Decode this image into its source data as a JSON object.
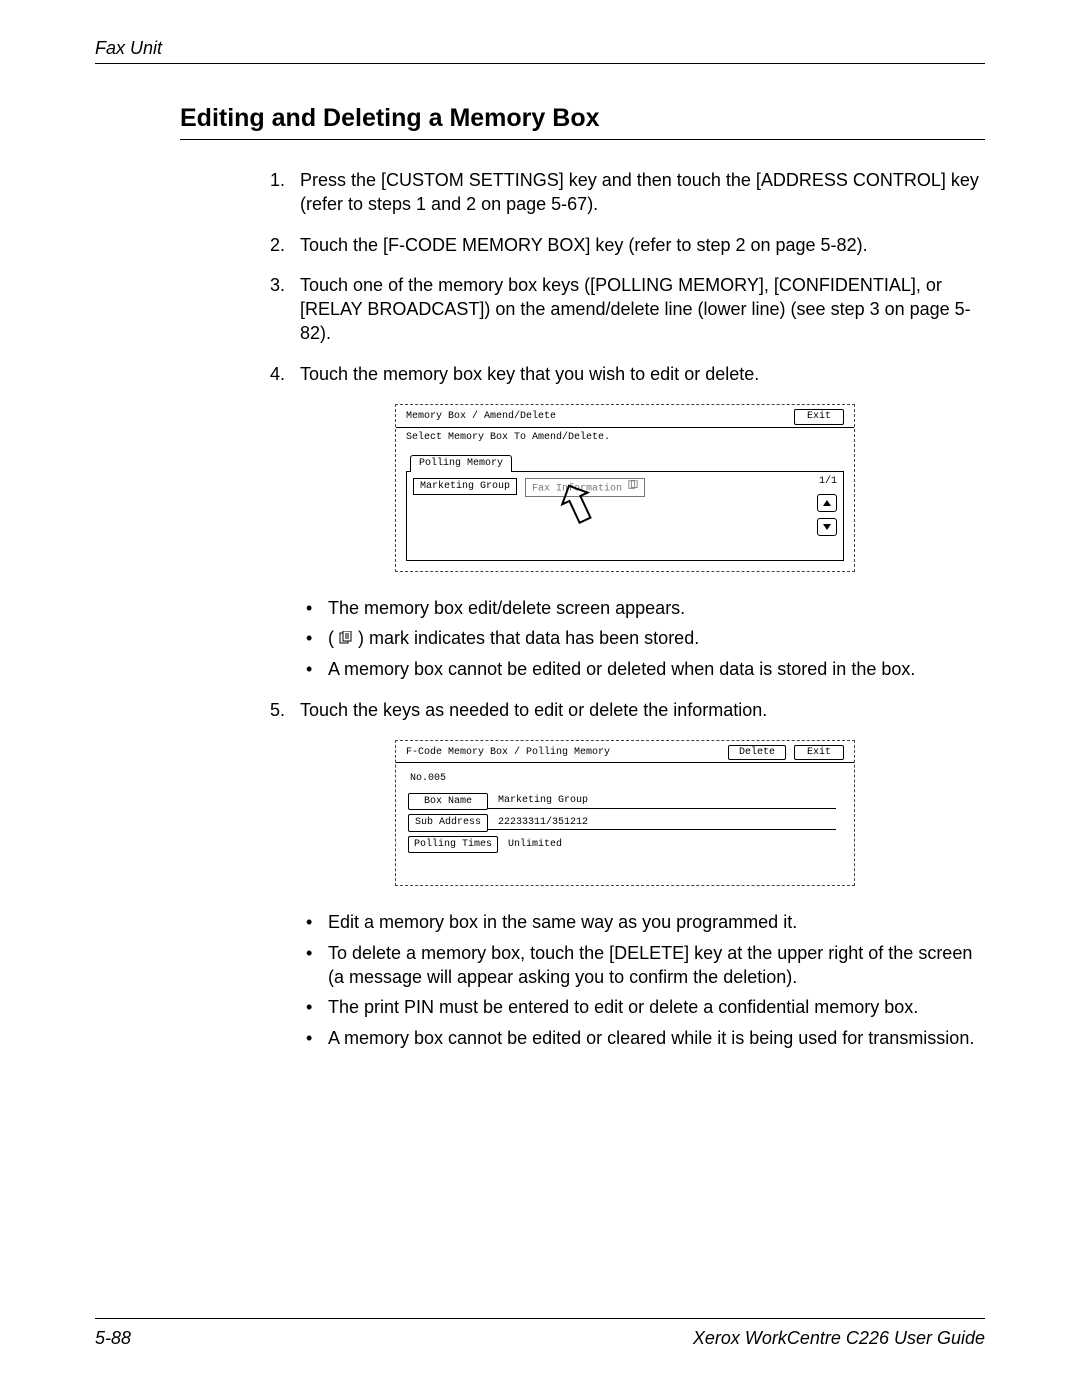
{
  "runningHead": "Fax Unit",
  "sectionTitle": "Editing and Deleting a Memory Box",
  "steps": {
    "s1": "Press the [CUSTOM SETTINGS] key and then touch the [ADDRESS CONTROL] key (refer to steps 1 and 2 on page 5-67).",
    "s2": "Touch the [F-CODE MEMORY BOX] key (refer to step 2 on page 5-82).",
    "s3": "Touch one of the memory box keys ([POLLING MEMORY], [CONFIDENTIAL], or [RELAY BROADCAST]) on the amend/delete line (lower line) (see step 3 on page 5-82).",
    "s4": "Touch the memory box key that you wish to edit or delete.",
    "s5": "Touch the keys as needed to edit or delete the information."
  },
  "panel1": {
    "title": "Memory Box / Amend/Delete",
    "exit": "Exit",
    "prompt": "Select Memory Box To Amend/Delete.",
    "tab": "Polling Memory",
    "key1": "Marketing Group",
    "key2": "Fax Information",
    "pager": "1/1"
  },
  "bulletsA": {
    "b1": "The memory box edit/delete screen appears.",
    "b2a": "( ",
    "b2b": " ) mark indicates that data has been stored.",
    "b3": "A memory box cannot be edited or deleted when data is stored in the box."
  },
  "panel2": {
    "title": "F-Code Memory Box / Polling Memory",
    "delete": "Delete",
    "exit": "Exit",
    "no": "No.005",
    "boxNameLbl": "Box Name",
    "boxNameVal": "Marketing Group",
    "subAddrLbl": "Sub Address",
    "subAddrVal": "22233311/351212",
    "pollLbl": "Polling Times",
    "pollVal": "Unlimited"
  },
  "bulletsB": {
    "b1": "Edit a memory box in the same way as you programmed it.",
    "b2": "To delete a memory box, touch the [DELETE] key at the upper right of the screen (a message will appear asking you to confirm the deletion).",
    "b3": "The print PIN must be entered to edit or delete a confidential memory box.",
    "b4": "A memory box cannot be edited or cleared while it is being used for transmission."
  },
  "footer": {
    "left": "5-88",
    "right": "Xerox WorkCentre C226 User Guide"
  }
}
